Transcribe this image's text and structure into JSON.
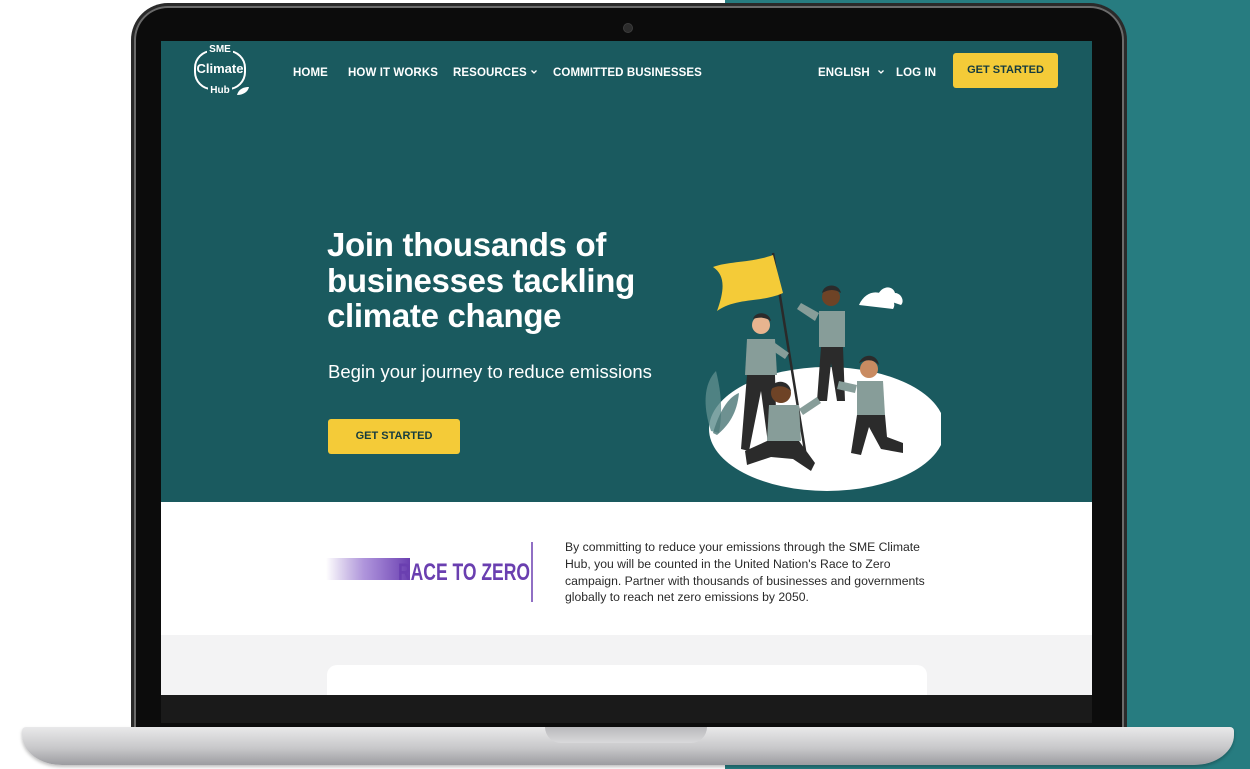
{
  "brand": {
    "logo_line1": "SME",
    "logo_line2": "Climate",
    "logo_line3": "Hub"
  },
  "nav": {
    "items": [
      {
        "label": "HOME"
      },
      {
        "label": "HOW IT WORKS"
      },
      {
        "label": "RESOURCES"
      },
      {
        "label": "COMMITTED BUSINESSES"
      }
    ],
    "language": "ENGLISH",
    "login": "LOG IN",
    "cta": "GET STARTED"
  },
  "hero": {
    "title": "Join thousands of businesses tackling climate change",
    "subtitle": "Begin your journey to reduce emissions",
    "cta": "GET STARTED"
  },
  "race_to_zero": {
    "logo_text": "RACE TO ZERO",
    "description": "By committing to reduce your emissions through the SME Climate Hub, you will be counted in the United Nation's Race to Zero campaign. Partner with thousands of businesses and governments globally to reach net zero emissions by 2050."
  },
  "icons": {
    "resources_dropdown": "chevron-down-icon",
    "language_dropdown": "chevron-down-icon",
    "logo_leaf": "leaf-icon"
  },
  "colors": {
    "hero_bg": "#1a5a5f",
    "accent_yellow": "#f4cb38",
    "side_panel": "#277c80",
    "race_purple": "#6a3fb0"
  }
}
